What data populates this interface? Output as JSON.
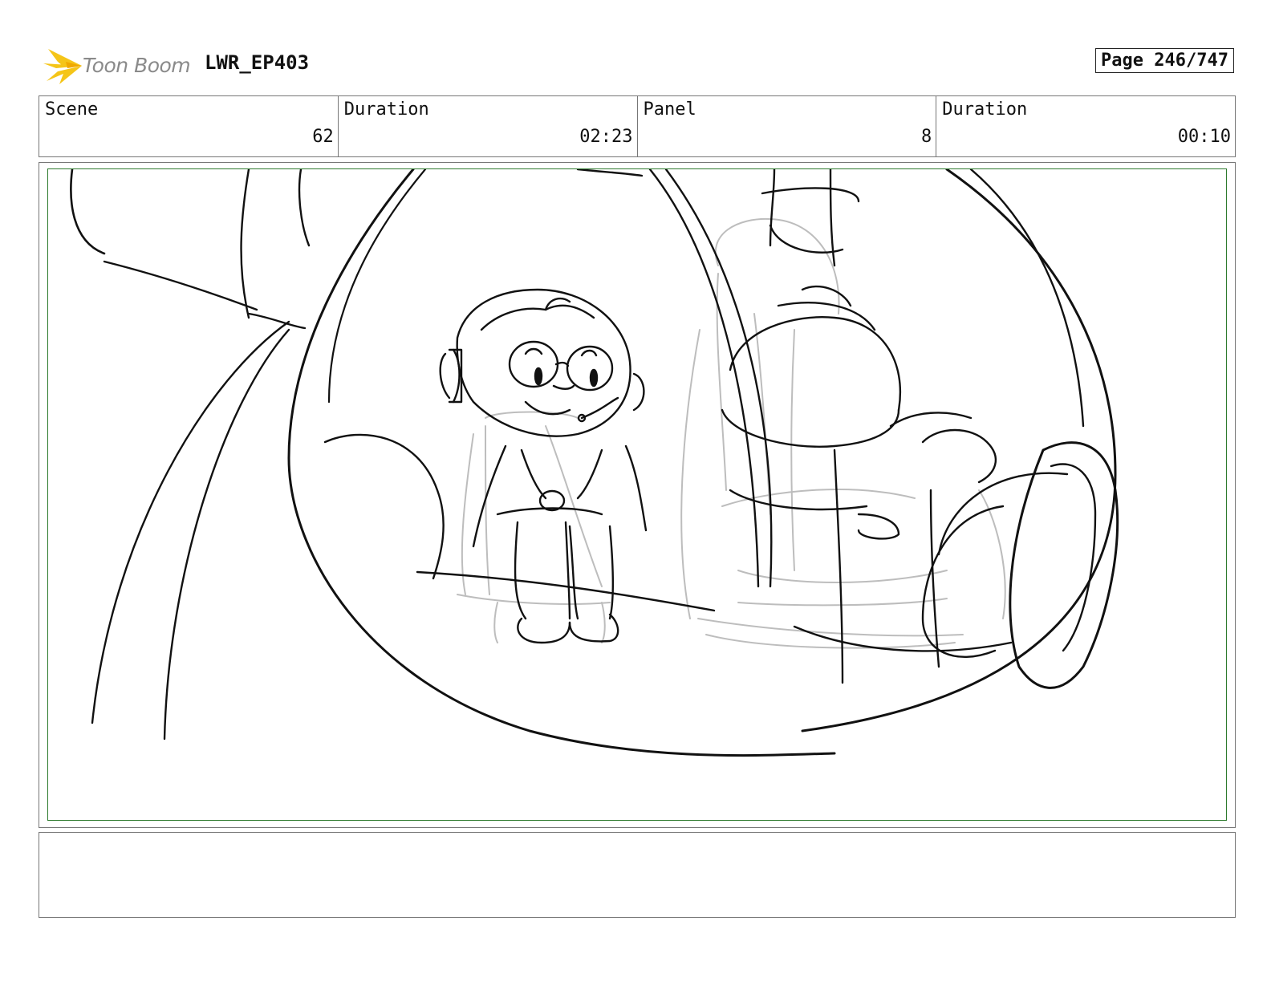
{
  "header": {
    "logo_text": "Toon Boom",
    "project_title": "LWR_EP403",
    "page_indicator": "Page 246/747",
    "logo_color": "#f5c518"
  },
  "info": {
    "scene_label": "Scene",
    "scene_value": "62",
    "scene_duration_label": "Duration",
    "scene_duration_value": "02:23",
    "panel_label": "Panel",
    "panel_value": "8",
    "panel_duration_label": "Duration",
    "panel_duration_value": "00:10"
  },
  "panel": {
    "safe_area_color": "#2d7a2d"
  },
  "notes": {
    "text": ""
  }
}
